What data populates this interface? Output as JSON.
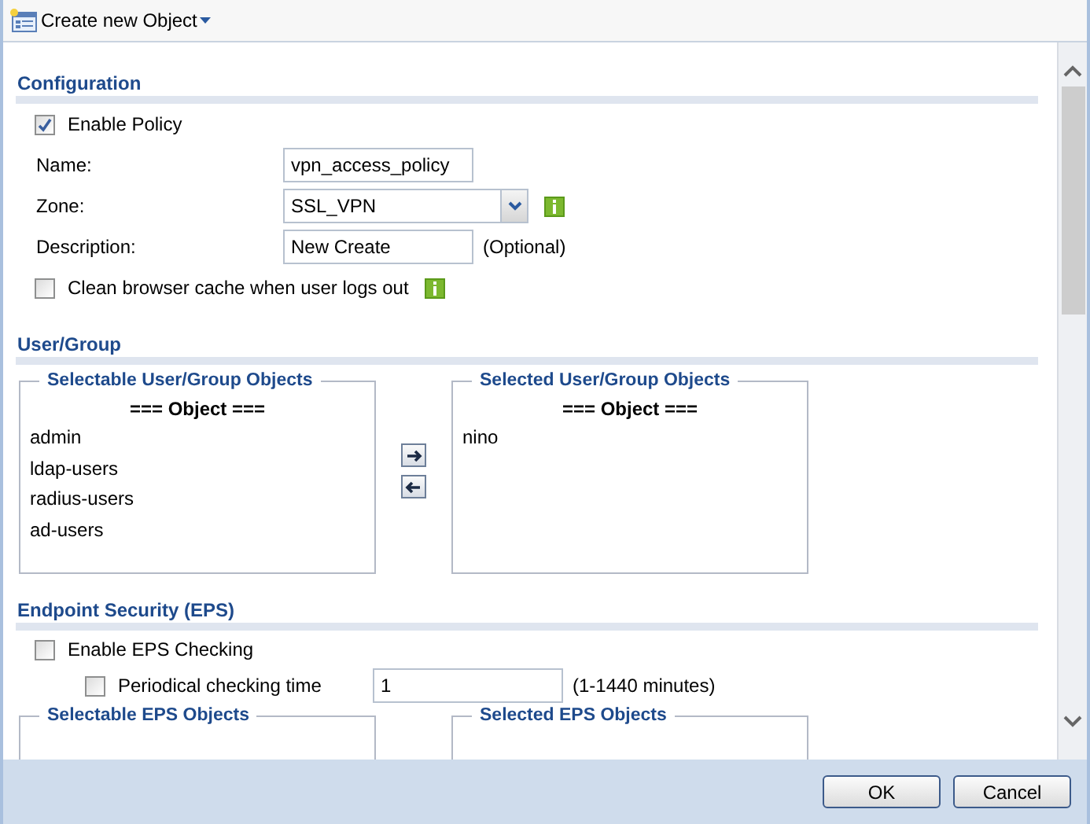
{
  "toolbar": {
    "title": "Create new Object"
  },
  "sections": [
    {
      "title": "Configuration",
      "rows": [
        {
          "kind": "checkbox",
          "label": "Enable Policy",
          "checked": true
        },
        {
          "kind": "text",
          "label": "Name:",
          "value": "vpn_access_policy"
        },
        {
          "kind": "select",
          "label": "Zone:",
          "value": "SSL_VPN",
          "info": true
        },
        {
          "kind": "text",
          "label": "Description:",
          "value": "New Create",
          "note": "(Optional)"
        },
        {
          "kind": "checkbox",
          "label": "Clean browser cache when user logs out",
          "checked": false,
          "info": true
        }
      ]
    },
    {
      "title": "User/Group",
      "rows": [
        {
          "kind": "transfer",
          "selectable": {
            "legend": "Selectable User/Group Objects",
            "header": "=== Object ===",
            "items": [
              "admin",
              "ldap-users",
              "radius-users",
              "ad-users"
            ]
          },
          "selected": {
            "legend": "Selected User/Group Objects",
            "header": "=== Object ===",
            "items": [
              "nino"
            ]
          }
        }
      ]
    },
    {
      "title": "Endpoint Security (EPS)",
      "rows": [
        {
          "kind": "checkbox",
          "label": "Enable EPS Checking",
          "checked": false,
          "children": [
            {
              "kind": "checkbox",
              "label": "Periodical checking time",
              "checked": false,
              "value": "1",
              "note": "(1-1440 minutes)"
            }
          ]
        },
        {
          "kind": "transfer",
          "selectable": {
            "legend": "Selectable EPS Objects"
          },
          "selected": {
            "legend": "Selected EPS Objects"
          }
        }
      ]
    }
  ],
  "buttons": [
    "OK",
    "Cancel"
  ]
}
